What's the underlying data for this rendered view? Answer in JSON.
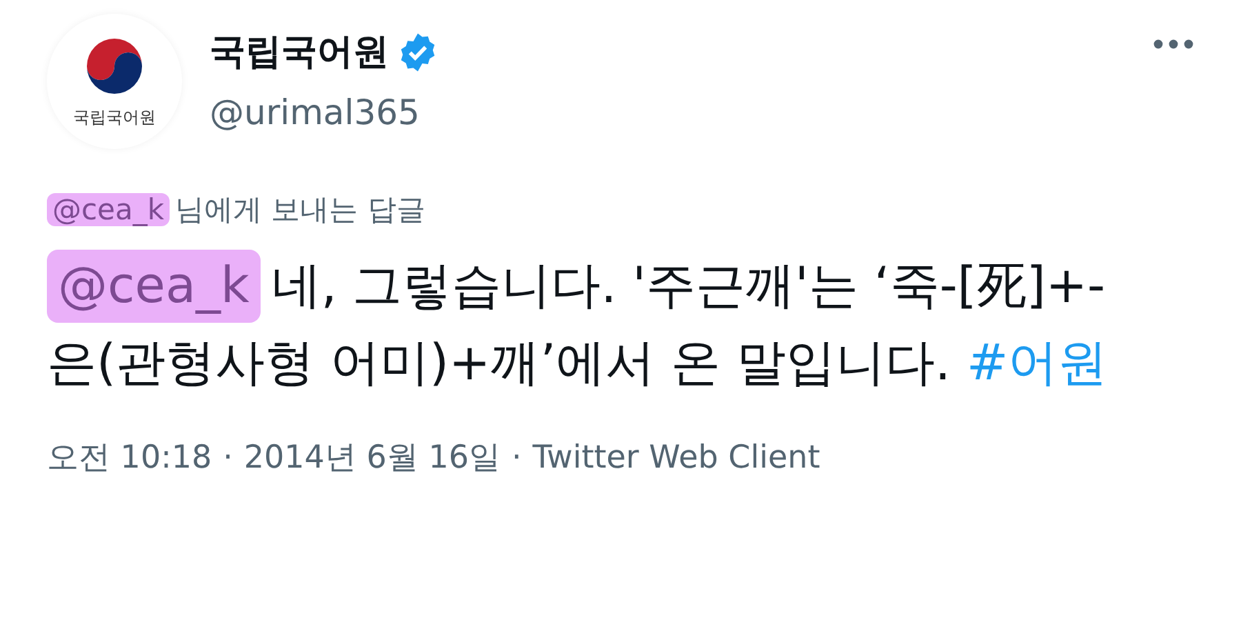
{
  "account": {
    "name": "국립국어원",
    "verified": true,
    "handle": "@urimal365",
    "logo_text": "국립국어원"
  },
  "reply_to": {
    "mention": "@cea_k",
    "text": "님에게 보내는 답글",
    "redacted": true
  },
  "body": {
    "mention": "@cea_k",
    "redacted": true,
    "text": "네,  그렇습니다. '주근깨'는 ‘죽-[死]+-은(관형사형 어미)+깨’에서 온 말입니다.",
    "hashtag": "#어원"
  },
  "meta": [
    "오전 10:18",
    "·",
    "2014년 6월 16일",
    "·",
    "Twitter Web Client"
  ]
}
